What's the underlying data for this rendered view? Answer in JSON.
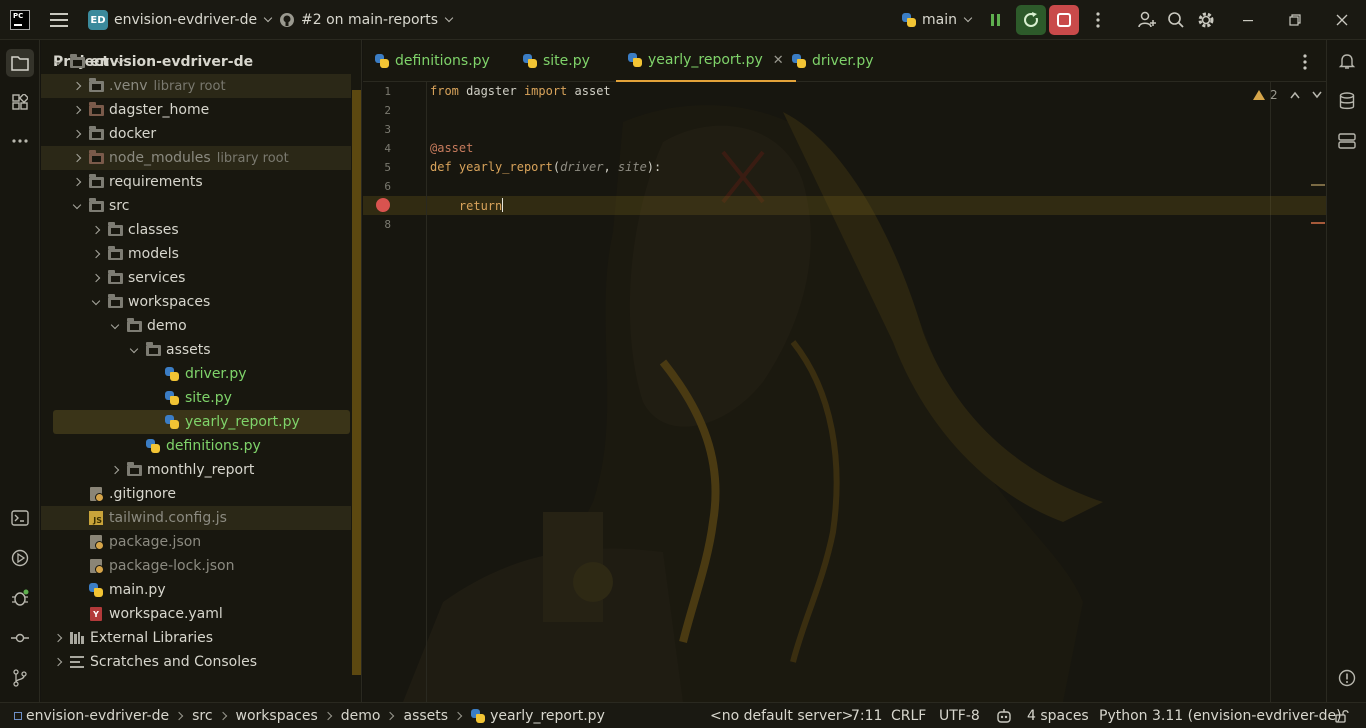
{
  "titlebar": {
    "app_logo_text": "PC",
    "project_badge": "ED",
    "project_name": "envision-evdriver-de",
    "pr_label": "#2 on main-reports",
    "branch": "main"
  },
  "project_panel": {
    "title": "Project",
    "tree": [
      {
        "label": "envision-evdriver-de",
        "depth": 0,
        "expanded": true,
        "kind": "folder"
      },
      {
        "label": ".venv",
        "hint": "library root",
        "depth": 1,
        "expanded": false,
        "kind": "folder",
        "dim": true
      },
      {
        "label": "dagster_home",
        "depth": 1,
        "expanded": false,
        "kind": "folder-brown"
      },
      {
        "label": "docker",
        "depth": 1,
        "expanded": false,
        "kind": "folder"
      },
      {
        "label": "node_modules",
        "hint": "library root",
        "depth": 1,
        "expanded": false,
        "kind": "folder-brown",
        "dim": true
      },
      {
        "label": "requirements",
        "depth": 1,
        "expanded": false,
        "kind": "folder"
      },
      {
        "label": "src",
        "depth": 1,
        "expanded": true,
        "kind": "folder"
      },
      {
        "label": "classes",
        "depth": 2,
        "expanded": false,
        "kind": "folder"
      },
      {
        "label": "models",
        "depth": 2,
        "expanded": false,
        "kind": "folder"
      },
      {
        "label": "services",
        "depth": 2,
        "expanded": false,
        "kind": "folder"
      },
      {
        "label": "workspaces",
        "depth": 2,
        "expanded": true,
        "kind": "folder"
      },
      {
        "label": "demo",
        "depth": 3,
        "expanded": true,
        "kind": "folder"
      },
      {
        "label": "assets",
        "depth": 4,
        "expanded": true,
        "kind": "folder"
      },
      {
        "label": "driver.py",
        "depth": 5,
        "kind": "py",
        "green": true
      },
      {
        "label": "site.py",
        "depth": 5,
        "kind": "py",
        "green": true
      },
      {
        "label": "yearly_report.py",
        "depth": 5,
        "kind": "py",
        "green": true,
        "selected": true
      },
      {
        "label": "definitions.py",
        "depth": 4,
        "kind": "py",
        "green": true
      },
      {
        "label": "monthly_report",
        "depth": 3,
        "expanded": false,
        "kind": "folder"
      },
      {
        "label": ".gitignore",
        "depth": 1,
        "kind": "gearfile"
      },
      {
        "label": "tailwind.config.js",
        "depth": 1,
        "kind": "js",
        "dim": true
      },
      {
        "label": "package.json",
        "depth": 1,
        "kind": "gearfile",
        "dim": true
      },
      {
        "label": "package-lock.json",
        "depth": 1,
        "kind": "gearfile",
        "dim": true
      },
      {
        "label": "main.py",
        "depth": 1,
        "kind": "py"
      },
      {
        "label": "workspace.yaml",
        "depth": 1,
        "kind": "yaml"
      },
      {
        "label": "External Libraries",
        "depth": 0,
        "expanded": false,
        "kind": "lib"
      },
      {
        "label": "Scratches and Consoles",
        "depth": 0,
        "expanded": false,
        "kind": "scratch"
      }
    ]
  },
  "tabs": [
    {
      "label": "definitions.py",
      "active": false
    },
    {
      "label": "site.py",
      "active": false
    },
    {
      "label": "yearly_report.py",
      "active": true
    },
    {
      "label": "driver.py",
      "active": false
    }
  ],
  "editor": {
    "line_numbers": [
      "1",
      "2",
      "3",
      "4",
      "5",
      "6",
      "7",
      "8"
    ],
    "warning_count": "2",
    "code": {
      "l1_from": "from",
      "l1_mod": " dagster ",
      "l1_import": "import",
      "l1_name": " asset",
      "l4_decorator": "@asset",
      "l5_def": "def",
      "l5_fn": "yearly_report",
      "l5_open": "(",
      "l5_p1": "driver",
      "l5_comma": ", ",
      "l5_p2": "site",
      "l5_close": "):",
      "l7_indent": "    ",
      "l7_return": "return"
    }
  },
  "statusbar": {
    "breadcrumb": [
      "envision-evdriver-de",
      "src",
      "workspaces",
      "demo",
      "assets",
      "yearly_report.py"
    ],
    "server": "<no default server>",
    "position": "7:11",
    "line_sep": "CRLF",
    "encoding": "UTF-8",
    "indent": "4 spaces",
    "interpreter": "Python 3.11 (envision-evdriver-de)"
  },
  "colors": {
    "accent_tab": "#e3a33a",
    "vcs_added": "#7fd36a",
    "breakpoint": "#d9534f"
  }
}
